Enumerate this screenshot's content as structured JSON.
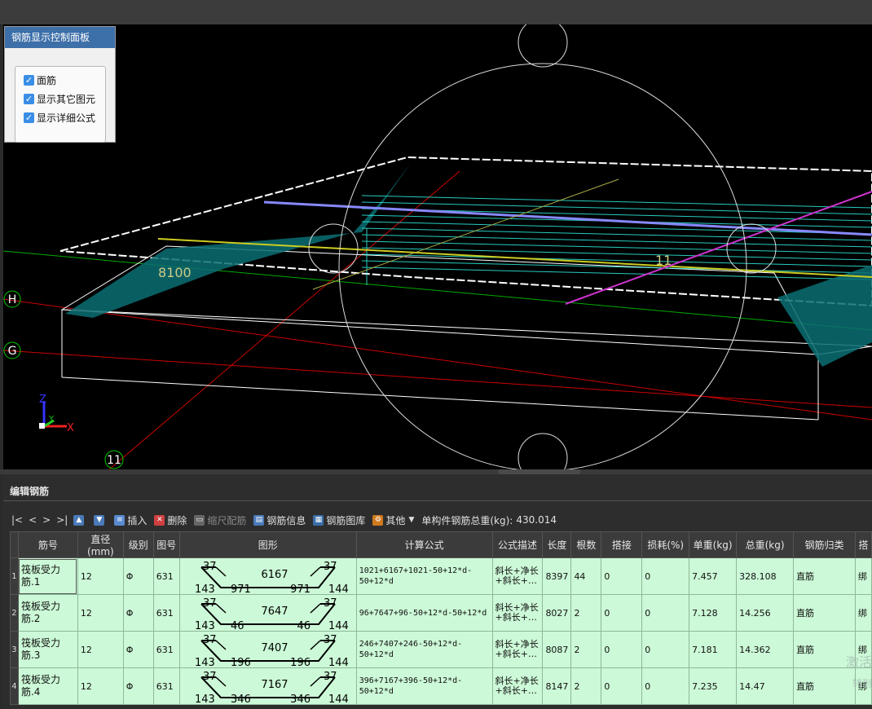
{
  "control_panel": {
    "title": "钢筋显示控制面板",
    "options": [
      {
        "label": "面筋",
        "checked": true
      },
      {
        "label": "显示其它图元",
        "checked": true
      },
      {
        "label": "显示详细公式",
        "checked": true
      }
    ]
  },
  "viewport": {
    "axis_labels": {
      "H": "H",
      "G": "G",
      "eleven": "11"
    },
    "dimension_text": "8100",
    "center_label": "11",
    "triad": {
      "x": "X",
      "y": "Y",
      "z": "Z"
    }
  },
  "editor": {
    "title": "编辑钢筋",
    "toolbar": {
      "nav": [
        "|<",
        "<",
        ">",
        ">|"
      ],
      "insert": "插入",
      "delete": "删除",
      "scale": "缩尺配筋",
      "info": "钢筋信息",
      "library": "钢筋图库",
      "other": "其他",
      "total_label": "单构件钢筋总重(kg):",
      "total_value": "430.014"
    },
    "columns": [
      "筋号",
      "直径(mm)",
      "级别",
      "图号",
      "图形",
      "计算公式",
      "公式描述",
      "长度",
      "根数",
      "搭接",
      "损耗(%)",
      "单重(kg)",
      "总重(kg)",
      "钢筋归类",
      "搭"
    ],
    "rows": [
      {
        "num": "1",
        "name": "筏板受力筋.1",
        "dia": "12",
        "grade": "Φ",
        "fig": "631",
        "s_tl": "37",
        "s_tr": "37",
        "s_mid": "6167",
        "s_bl": "143",
        "s_br": "144",
        "s_il": "971",
        "s_ir": "971",
        "formula": "1021+6167+1021-50+12*d-50+12*d",
        "desc": "斜长+净长+斜长+…",
        "len": "8397",
        "count": "44",
        "lap": "0",
        "loss": "0",
        "unit": "7.457",
        "total": "328.108",
        "cat": "直筋",
        "last": "绑"
      },
      {
        "num": "2",
        "name": "筏板受力筋.2",
        "dia": "12",
        "grade": "Φ",
        "fig": "631",
        "s_tl": "37",
        "s_tr": "37",
        "s_mid": "7647",
        "s_bl": "143",
        "s_br": "144",
        "s_il": "46",
        "s_ir": "46",
        "formula": "96+7647+96-50+12*d-50+12*d",
        "desc": "斜长+净长+斜长+…",
        "len": "8027",
        "count": "2",
        "lap": "0",
        "loss": "0",
        "unit": "7.128",
        "total": "14.256",
        "cat": "直筋",
        "last": "绑"
      },
      {
        "num": "3",
        "name": "筏板受力筋.3",
        "dia": "12",
        "grade": "Φ",
        "fig": "631",
        "s_tl": "37",
        "s_tr": "37",
        "s_mid": "7407",
        "s_bl": "143",
        "s_br": "144",
        "s_il": "196",
        "s_ir": "196",
        "formula": "246+7407+246-50+12*d-50+12*d",
        "desc": "斜长+净长+斜长+…",
        "len": "8087",
        "count": "2",
        "lap": "0",
        "loss": "0",
        "unit": "7.181",
        "total": "14.362",
        "cat": "直筋",
        "last": "绑"
      },
      {
        "num": "4",
        "name": "筏板受力筋.4",
        "dia": "12",
        "grade": "Φ",
        "fig": "631",
        "s_tl": "37",
        "s_tr": "37",
        "s_mid": "7167",
        "s_bl": "143",
        "s_br": "144",
        "s_il": "346",
        "s_ir": "346",
        "formula": "396+7167+396-50+12*d-50+12*d",
        "desc": "斜长+净长+斜长+…",
        "len": "8147",
        "count": "2",
        "lap": "0",
        "loss": "0",
        "unit": "7.235",
        "total": "14.47",
        "cat": "直筋",
        "last": "绑"
      }
    ]
  },
  "watermark": {
    "line1": "激活",
    "line2": "转到"
  }
}
